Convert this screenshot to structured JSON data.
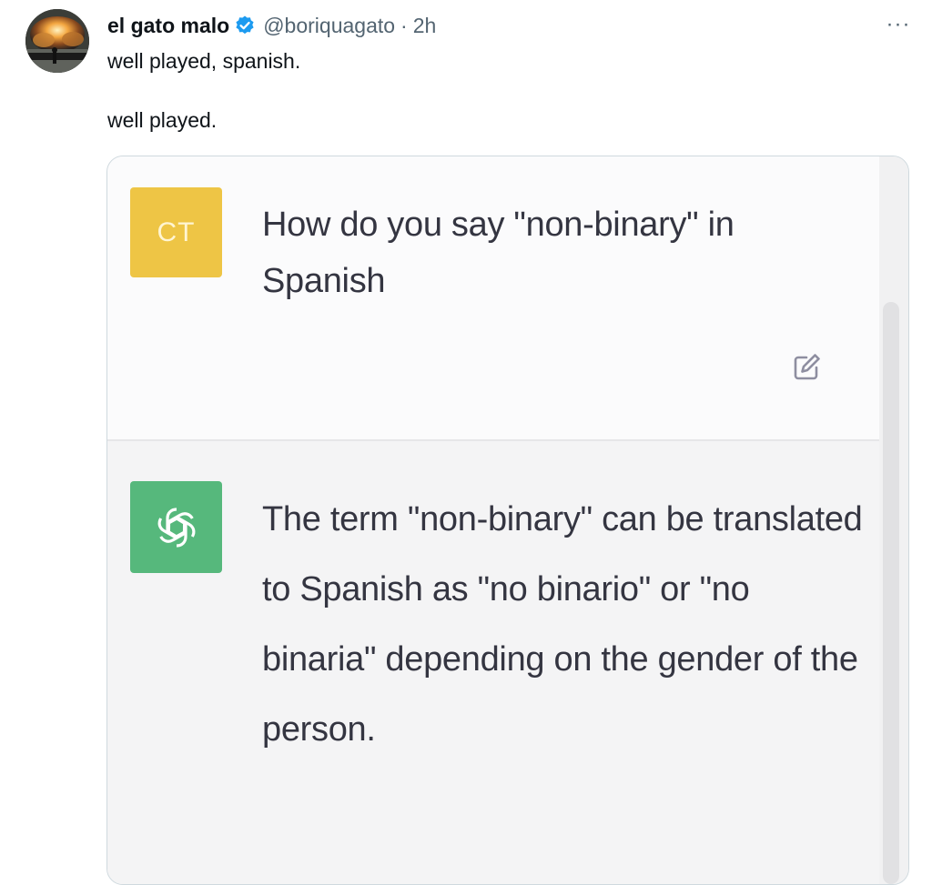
{
  "author": {
    "display_name": "el gato malo",
    "handle": "@boriquagato",
    "separator": "·",
    "time": "2h",
    "verified_icon": "verified-badge-icon",
    "verified_color": "#1d9bf0"
  },
  "tweet": {
    "line1": "well played, spanish.",
    "line2": "well played."
  },
  "more_menu": {
    "label": "···",
    "icon": "more-dots-icon"
  },
  "chat": {
    "user_avatar_label": "CT",
    "user_avatar_color": "#eec545",
    "question": "How do you say \"non-binary\" in Spanish",
    "edit_icon": "edit-icon",
    "assistant_avatar_icon": "openai-logo-icon",
    "assistant_avatar_color": "#56b87c",
    "answer": "The term \"non-binary\" can be translated to Spanish as \"no binario\" or \"no binaria\" depending on the gender of the person."
  }
}
